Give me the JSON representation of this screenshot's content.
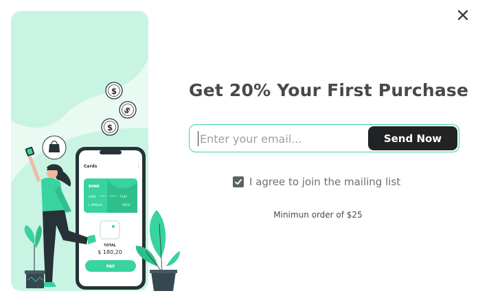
{
  "popup": {
    "headline": "Get 20% Your First Purchase",
    "email_placeholder": "Enter your email...",
    "send_label": "Send Now",
    "agree_label": "I agree to join the mailing list",
    "agree_checked": true,
    "min_order": "Minimun order of $25",
    "close_icon": "close-icon"
  },
  "illustration": {
    "phone_title": "Cards",
    "card_bank": "BANK",
    "card_numbers": [
      "4364",
      "****",
      "****",
      "7342"
    ],
    "card_holder": "J. Williams",
    "card_expiry": "09/24",
    "total_label": "TOTAL",
    "total_value": "$ 180,20",
    "pay_label": "PAY",
    "coin_symbol": "$"
  },
  "colors": {
    "accent": "#38d39f",
    "accent_light": "#c9f4e3",
    "panel_bg": "#e9faf3",
    "button_dark": "#222325",
    "headline": "#474a4c"
  }
}
